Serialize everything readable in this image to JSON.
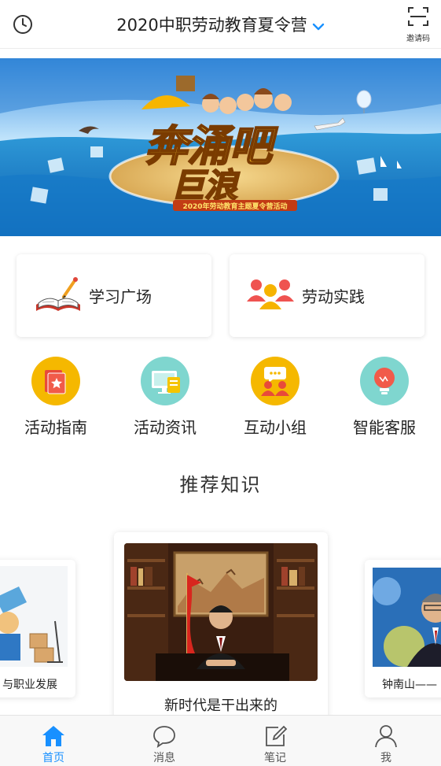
{
  "header": {
    "title": "2020中职劳动教育夏令营",
    "invite_label": "邀请码"
  },
  "banner": {
    "headline_line1": "奔涌吧",
    "headline_line2": "巨浪",
    "subtitle": "2020年劳动教育主题夏令营活动"
  },
  "feature_cards": [
    {
      "label": "学习广场",
      "icon": "open-book-icon"
    },
    {
      "label": "劳动实践",
      "icon": "group-people-icon"
    }
  ],
  "quick_entries": [
    {
      "label": "活动指南",
      "icon": "guide-book-icon",
      "color": "#f5b800"
    },
    {
      "label": "活动资讯",
      "icon": "news-monitor-icon",
      "color": "#7fd6cf"
    },
    {
      "label": "互动小组",
      "icon": "chat-group-icon",
      "color": "#f5b800"
    },
    {
      "label": "智能客服",
      "icon": "lightbulb-icon",
      "color": "#7fd6cf"
    }
  ],
  "section_title": "推荐知识",
  "knowledge_cards": [
    {
      "label": "与职业发展"
    },
    {
      "label": "新时代是干出来的"
    },
    {
      "label": "钟南山——"
    }
  ],
  "tabbar": [
    {
      "label": "首页",
      "icon": "home-icon",
      "active": true
    },
    {
      "label": "消息",
      "icon": "message-icon",
      "active": false
    },
    {
      "label": "笔记",
      "icon": "note-edit-icon",
      "active": false
    },
    {
      "label": "我",
      "icon": "user-icon",
      "active": false
    }
  ],
  "colors": {
    "accent": "#1890ff",
    "yellow": "#f5b800",
    "teal": "#7fd6cf"
  }
}
